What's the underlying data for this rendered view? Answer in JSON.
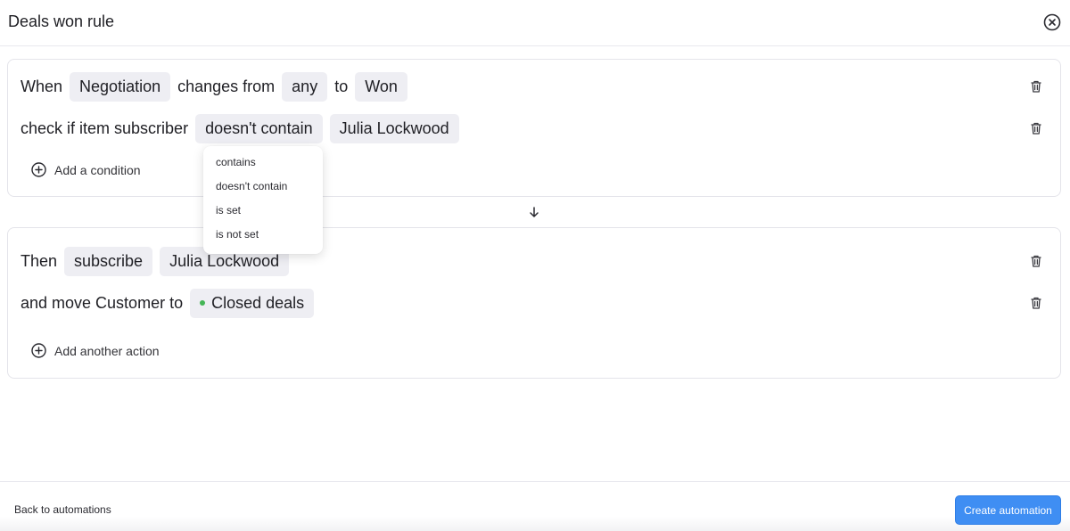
{
  "header": {
    "title": "Deals won rule"
  },
  "trigger": {
    "when_label": "When",
    "field": "Negotiation",
    "changes_from_label": "changes from",
    "from_value": "any",
    "to_label": "to",
    "to_value": "Won",
    "check_label": "check if item subscriber",
    "operator": "doesn't contain",
    "subject": "Julia Lockwood",
    "add_condition_label": "Add a condition"
  },
  "operator_dropdown": {
    "options": [
      "contains",
      "doesn't contain",
      "is set",
      "is not set"
    ]
  },
  "actions": {
    "then_label": "Then",
    "action": "subscribe",
    "action_target": "Julia Lockwood",
    "move_label": "and move Customer to",
    "stage": "Closed deals",
    "stage_color": "#44b556",
    "add_action_label": "Add another action"
  },
  "footer": {
    "back_label": "Back to automations",
    "create_label": "Create automation"
  },
  "icons": {
    "close": "close-circle-icon",
    "trash": "trash-icon",
    "add": "plus-circle-icon",
    "arrow": "arrow-down-icon"
  },
  "colors": {
    "accent": "#3f8ef3",
    "pill_bg": "#eeeef3"
  }
}
